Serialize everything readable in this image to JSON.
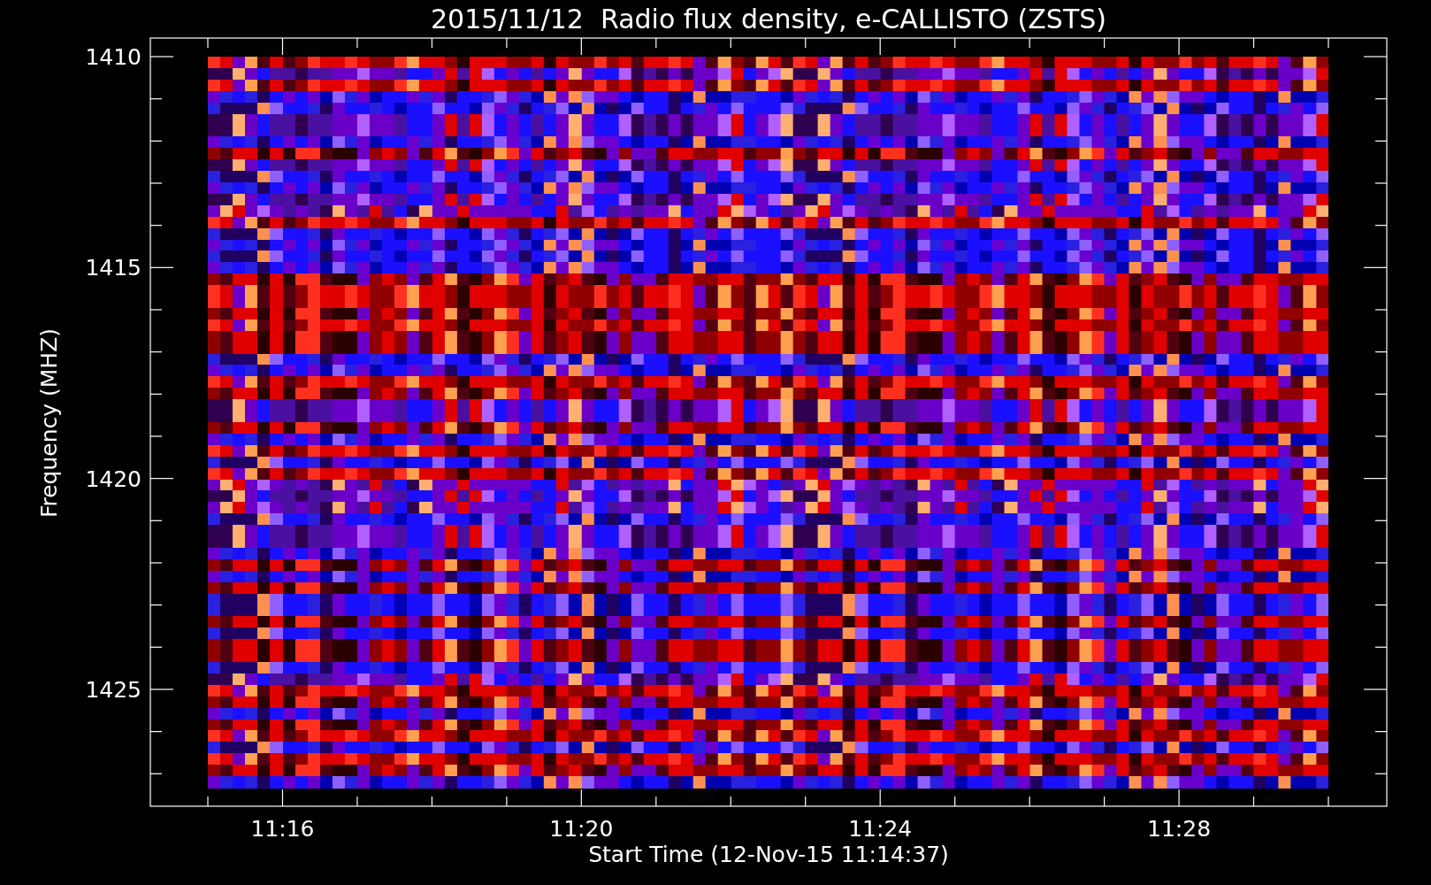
{
  "title": "2015/11/12  Radio flux density, e-CALLISTO (ZSTS)",
  "y_axis": {
    "label": "Frequency (MHZ)",
    "ticks": [
      "1410",
      "1415",
      "1420",
      "1425"
    ]
  },
  "x_axis": {
    "label": "Start Time (12-Nov-15 11:14:37)",
    "ticks": [
      "11:16",
      "11:20",
      "11:24",
      "11:28"
    ]
  }
}
